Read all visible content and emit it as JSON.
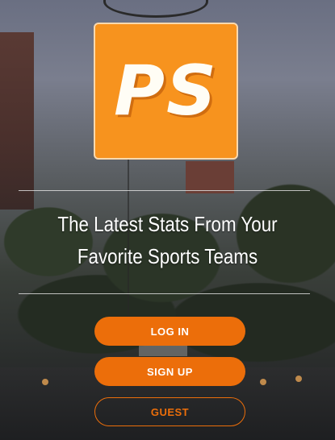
{
  "logo": {
    "text": "PS",
    "color": "#f7931e"
  },
  "tagline": "The Latest Stats From Your Favorite Sports Teams",
  "buttons": {
    "login": "LOG IN",
    "signup": "SIGN UP",
    "guest": "GUEST"
  },
  "colors": {
    "accent": "#ec6e0a"
  }
}
